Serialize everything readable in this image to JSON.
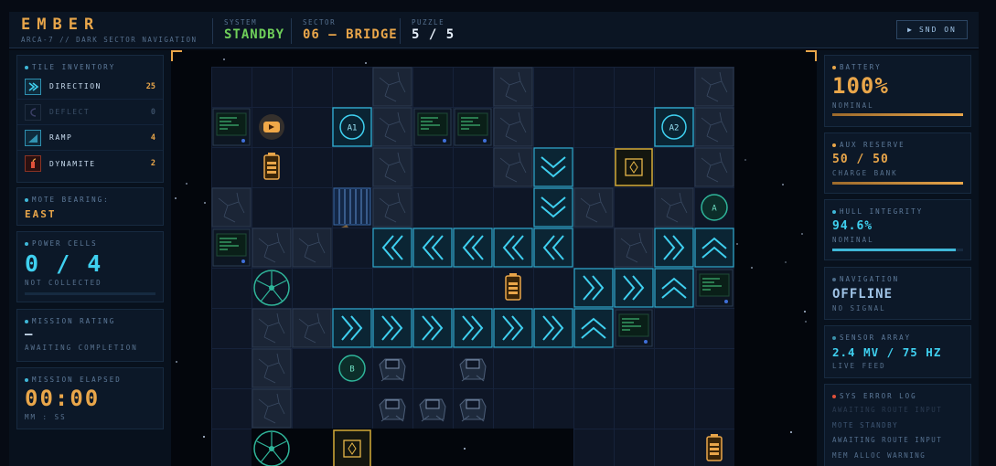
{
  "header": {
    "title": "EMBER",
    "subtitle": "ARCA-7 // DARK SECTOR NAVIGATION",
    "system_label": "SYSTEM",
    "system_value": "STANDBY",
    "sector_label": "SECTOR",
    "sector_value": "06 — BRIDGE",
    "puzzle_label": "PUZZLE",
    "puzzle_value": "5 / 5",
    "sound_button": "SND ON",
    "colors": {
      "accent": "#e9a64a",
      "standby": "#6fcf5a",
      "cyan": "#3fd0f0"
    }
  },
  "inventory": {
    "label": "TILE INVENTORY",
    "items": [
      {
        "name": "DIRECTION",
        "count": "25",
        "icon": "direction-icon"
      },
      {
        "name": "DEFLECT",
        "count": "0",
        "icon": "deflect-icon"
      },
      {
        "name": "RAMP",
        "count": "4",
        "icon": "ramp-icon"
      },
      {
        "name": "DYNAMITE",
        "count": "2",
        "icon": "dynamite-icon"
      }
    ]
  },
  "mote": {
    "label": "MOTE BEARING:",
    "value": "EAST"
  },
  "power": {
    "label": "POWER CELLS",
    "value": "0 / 4",
    "status": "NOT COLLECTED",
    "progress": 0
  },
  "rating": {
    "label": "MISSION RATING",
    "value": "—",
    "status": "AWAITING COMPLETION"
  },
  "elapsed": {
    "label": "MISSION ELAPSED",
    "value": "00:00",
    "format": "MM : SS"
  },
  "battery": {
    "label": "BATTERY",
    "value": "100%",
    "status": "NOMINAL",
    "level": 1.0
  },
  "aux": {
    "label": "AUX RESERVE",
    "value": "50 / 50",
    "status": "CHARGE BANK",
    "level": 1.0
  },
  "hull": {
    "label": "HULL INTEGRITY",
    "value": "94.6%",
    "status": "NOMINAL",
    "level": 0.946
  },
  "navigation": {
    "label": "NAVIGATION",
    "value": "OFFLINE",
    "status": "NO SIGNAL"
  },
  "sensor": {
    "label": "SENSOR ARRAY",
    "value": "2.4 MV / 75 HZ",
    "status": "LIVE FEED"
  },
  "errorlog": {
    "label": "SYS ERROR LOG",
    "lines": [
      "AWAITING ROUTE INPUT",
      "MOTE STANDBY",
      "AWAITING ROUTE INPUT",
      "MEM ALLOC WARNING"
    ]
  },
  "board": {
    "beacons": [
      "A1",
      "A2",
      "A",
      "B"
    ],
    "tiles": [
      {
        "t": "rock",
        "c": 5,
        "r": 0
      },
      {
        "t": "rock",
        "c": 8,
        "r": 0
      },
      {
        "t": "rock",
        "c": 13,
        "r": 0
      },
      {
        "t": "term",
        "c": 1,
        "r": 1
      },
      {
        "t": "mote",
        "c": 2,
        "r": 1
      },
      {
        "t": "beacon",
        "c": 4,
        "r": 1,
        "label": "A1"
      },
      {
        "t": "rock",
        "c": 5,
        "r": 1
      },
      {
        "t": "term",
        "c": 6,
        "r": 1
      },
      {
        "t": "term",
        "c": 7,
        "r": 1
      },
      {
        "t": "rock",
        "c": 8,
        "r": 1
      },
      {
        "t": "beacon",
        "c": 12,
        "r": 1,
        "label": "A2"
      },
      {
        "t": "rock",
        "c": 13,
        "r": 1
      },
      {
        "t": "cell",
        "c": 2,
        "r": 2
      },
      {
        "t": "rock",
        "c": 5,
        "r": 2
      },
      {
        "t": "rock",
        "c": 8,
        "r": 2
      },
      {
        "t": "arrow",
        "d": "down",
        "c": 9,
        "r": 2
      },
      {
        "t": "crate",
        "c": 11,
        "r": 2
      },
      {
        "t": "rock",
        "c": 13,
        "r": 2
      },
      {
        "t": "rock",
        "c": 1,
        "r": 3
      },
      {
        "t": "gate",
        "c": 4,
        "r": 3
      },
      {
        "t": "rock",
        "c": 5,
        "r": 3
      },
      {
        "t": "arrow",
        "d": "down",
        "c": 9,
        "r": 3
      },
      {
        "t": "rock",
        "c": 10,
        "r": 3
      },
      {
        "t": "rock",
        "c": 12,
        "r": 3
      },
      {
        "t": "node",
        "c": 13,
        "r": 3,
        "label": "A"
      },
      {
        "t": "term",
        "c": 1,
        "r": 4
      },
      {
        "t": "rock",
        "c": 2,
        "r": 4
      },
      {
        "t": "rock",
        "c": 3,
        "r": 4
      },
      {
        "t": "arrow",
        "d": "left",
        "c": 5,
        "r": 4
      },
      {
        "t": "arrow",
        "d": "left",
        "c": 6,
        "r": 4
      },
      {
        "t": "arrow",
        "d": "left",
        "c": 7,
        "r": 4
      },
      {
        "t": "arrow",
        "d": "left",
        "c": 8,
        "r": 4
      },
      {
        "t": "arrow",
        "d": "left",
        "c": 9,
        "r": 4
      },
      {
        "t": "rock",
        "c": 11,
        "r": 4
      },
      {
        "t": "arrow",
        "d": "right",
        "c": 12,
        "r": 4
      },
      {
        "t": "arrow",
        "d": "up",
        "c": 13,
        "r": 4
      },
      {
        "t": "fan",
        "c": 2,
        "r": 5
      },
      {
        "t": "cell",
        "c": 8,
        "r": 5
      },
      {
        "t": "arrow",
        "d": "right",
        "c": 10,
        "r": 5
      },
      {
        "t": "arrow",
        "d": "right",
        "c": 11,
        "r": 5
      },
      {
        "t": "arrow",
        "d": "up",
        "c": 12,
        "r": 5
      },
      {
        "t": "term",
        "c": 13,
        "r": 5
      },
      {
        "t": "rock",
        "c": 2,
        "r": 6
      },
      {
        "t": "rock",
        "c": 3,
        "r": 6
      },
      {
        "t": "arrow",
        "d": "right",
        "c": 4,
        "r": 6
      },
      {
        "t": "arrow",
        "d": "right",
        "c": 5,
        "r": 6
      },
      {
        "t": "arrow",
        "d": "right",
        "c": 6,
        "r": 6
      },
      {
        "t": "arrow",
        "d": "right",
        "c": 7,
        "r": 6
      },
      {
        "t": "arrow",
        "d": "right",
        "c": 8,
        "r": 6
      },
      {
        "t": "arrow",
        "d": "right",
        "c": 9,
        "r": 6
      },
      {
        "t": "arrow",
        "d": "up",
        "c": 10,
        "r": 6
      },
      {
        "t": "term",
        "c": 11,
        "r": 6
      },
      {
        "t": "rock",
        "c": 2,
        "r": 7
      },
      {
        "t": "node",
        "c": 4,
        "r": 7,
        "label": "B"
      },
      {
        "t": "bot",
        "c": 5,
        "r": 7
      },
      {
        "t": "bot",
        "c": 7,
        "r": 7
      },
      {
        "t": "rock",
        "c": 2,
        "r": 8
      },
      {
        "t": "bot",
        "c": 5,
        "r": 8
      },
      {
        "t": "bot",
        "c": 6,
        "r": 8
      },
      {
        "t": "bot",
        "c": 7,
        "r": 8
      },
      {
        "t": "fan",
        "c": 2,
        "r": 9
      },
      {
        "t": "crate",
        "c": 4,
        "r": 9
      },
      {
        "t": "cell",
        "c": 13,
        "r": 9
      }
    ]
  }
}
